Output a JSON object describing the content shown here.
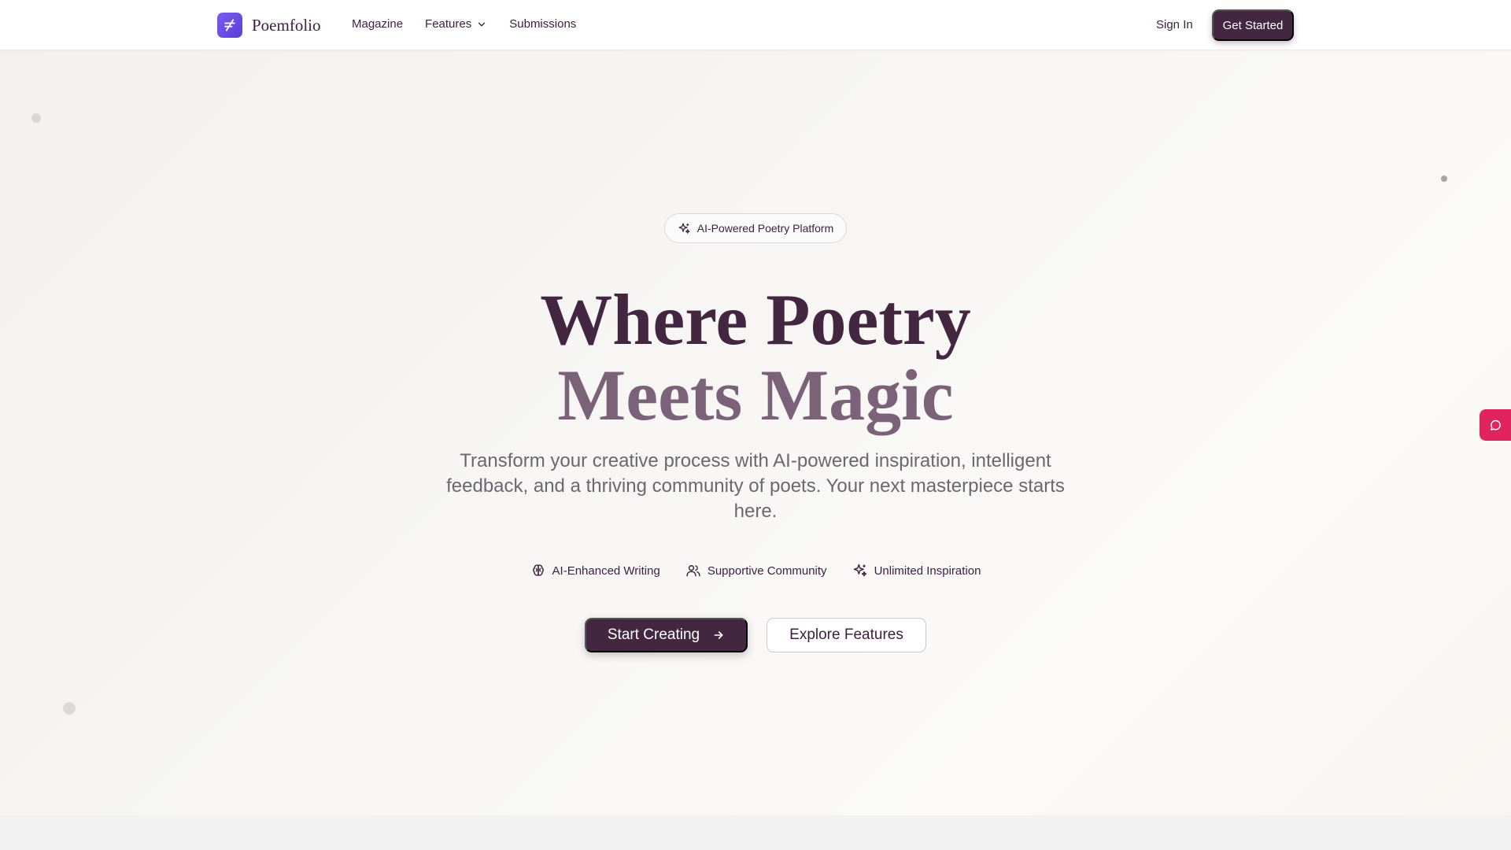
{
  "brand": {
    "name": "Poemfolio",
    "accent": "#6a4de6"
  },
  "nav": {
    "items": [
      {
        "label": "Magazine"
      },
      {
        "label": "Features",
        "has_dropdown": true
      },
      {
        "label": "Submissions"
      }
    ],
    "sign_in": "Sign In",
    "get_started": "Get Started"
  },
  "hero": {
    "badge": "AI-Powered Poetry Platform",
    "title_line_1": "Where Poetry",
    "title_line_2": "Meets Magic",
    "subtitle": "Transform your creative process with AI-powered inspiration, intelligent feedback, and a thriving community of poets. Your next masterpiece starts here.",
    "features": [
      {
        "icon": "brain-icon",
        "label": "AI-Enhanced Writing"
      },
      {
        "icon": "users-icon",
        "label": "Supportive Community"
      },
      {
        "icon": "sparkles-icon",
        "label": "Unlimited Inspiration"
      }
    ],
    "primary_cta": "Start Creating",
    "secondary_cta": "Explore Features"
  },
  "colors": {
    "primary": "#432640",
    "title_secondary": "#7a6278",
    "chat_tab": "#e0245e"
  },
  "chat": {
    "icon": "chat-bubble-icon"
  }
}
